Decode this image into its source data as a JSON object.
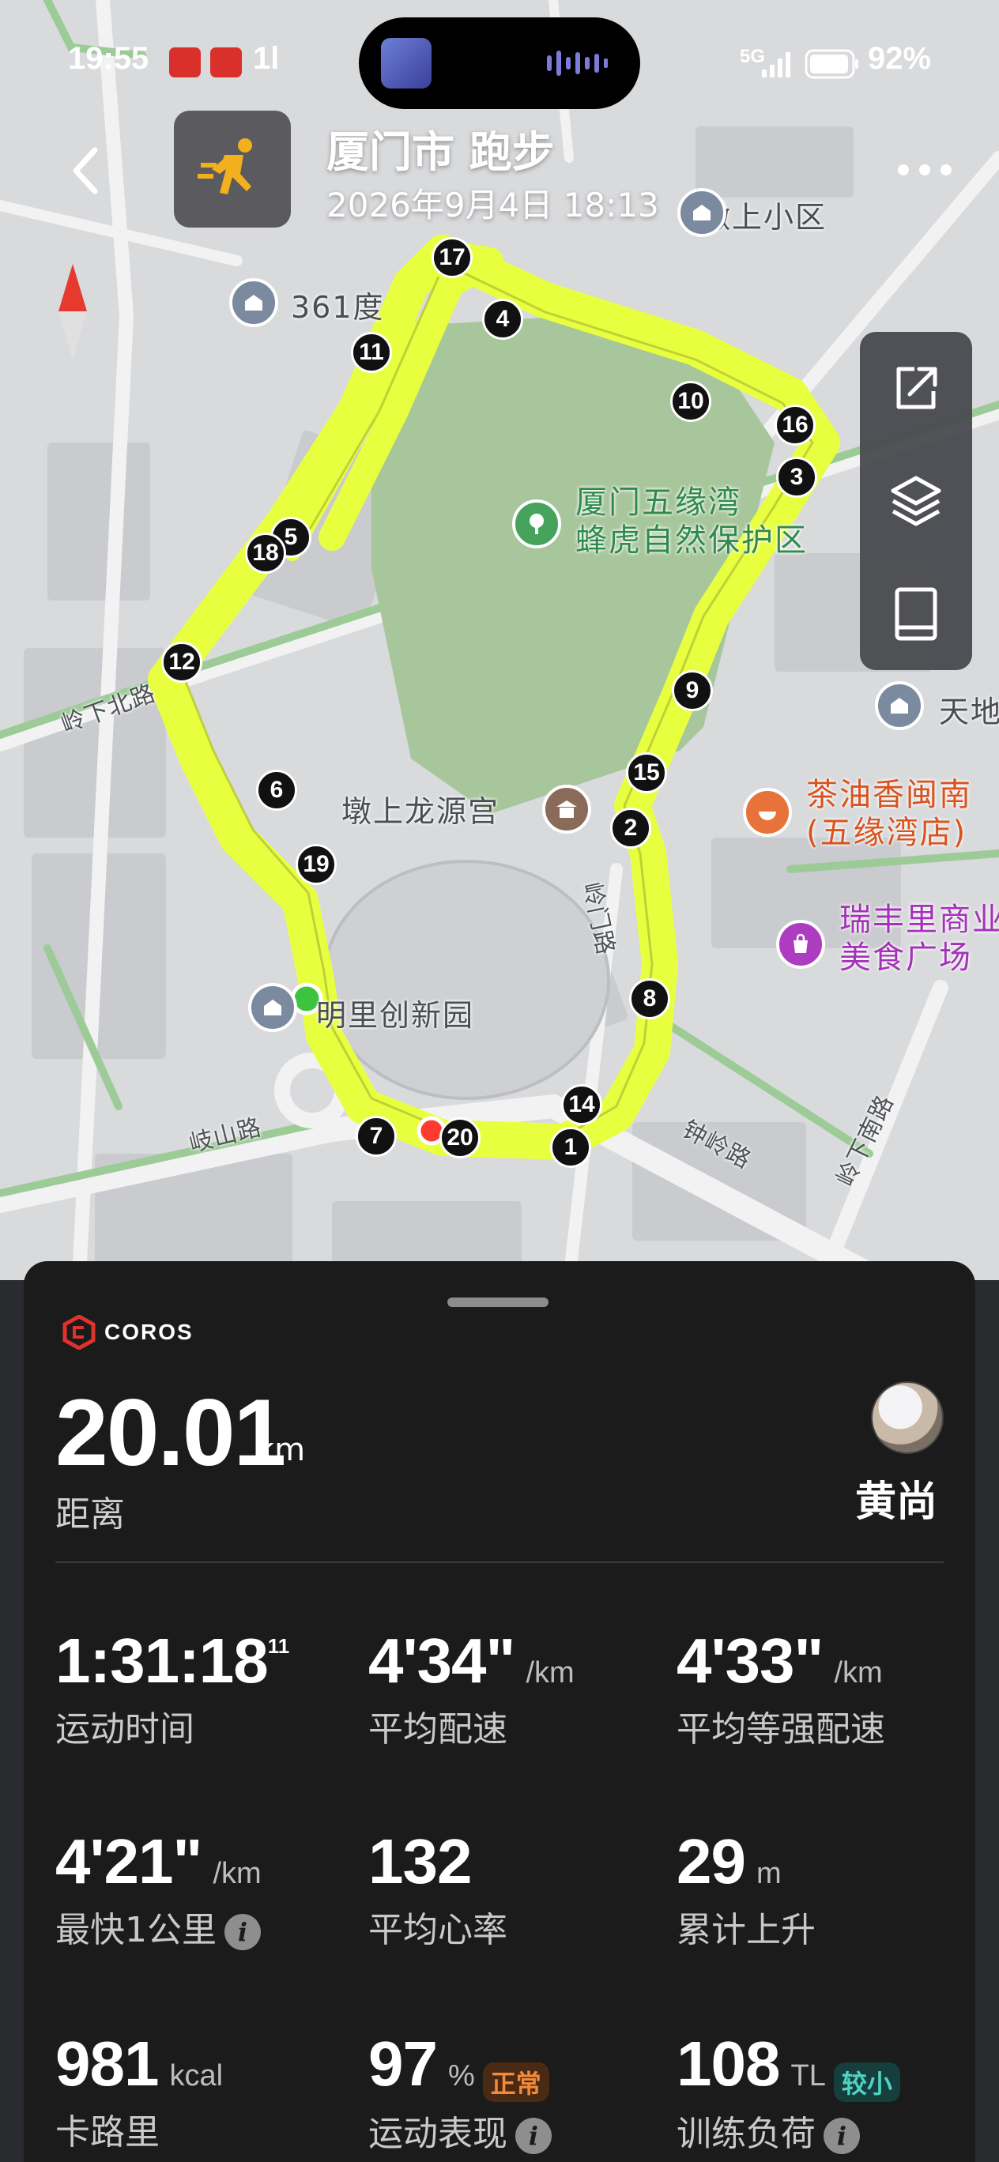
{
  "status_bar": {
    "time": "19:55",
    "signal_mark": "1l",
    "network": "5G",
    "battery": "92%"
  },
  "header": {
    "title": "厦门市 跑步",
    "date": "2026年9月4日 18:13"
  },
  "map": {
    "labels": {
      "dunshang_community": "墩上小区",
      "poi_361": "361度",
      "park_line1": "厦门五缘湾",
      "park_line2": "蜂虎自然保护区",
      "ling_xia_bei_lu": "岭下北路",
      "tian_di": "天地",
      "long_yuan_gong": "墩上龙源宫",
      "chayou_line1": "茶油香闽南",
      "chayou_line2": "(五缘湾店)",
      "ruifeng_line1": "瑞丰里商业",
      "ruifeng_line2": "美食广场",
      "mingli": "明里创新园",
      "qishan_lu": "岐山路",
      "zhongling_lu": "钟岭路",
      "lingmen_lu": "岭门路",
      "ling_xia_nan_lu": "岭下南路"
    },
    "km_markers": [
      "1",
      "2",
      "3",
      "4",
      "5",
      "6",
      "7",
      "8",
      "9",
      "10",
      "11",
      "12",
      "14",
      "15",
      "16",
      "17",
      "18",
      "19",
      "20"
    ],
    "route_color": "#e8ff3f",
    "start_color": "#3ec33e",
    "end_color": "#ff3b30"
  },
  "summary": {
    "brand": "COROS",
    "distance_value": "20.01",
    "distance_unit": "km",
    "distance_label": "距离",
    "user_name": "黄尚"
  },
  "stats": [
    {
      "value": "1:31:18",
      "sup": "11",
      "unit": "",
      "label": "运动时间"
    },
    {
      "value": "4'34\"",
      "unit": "/km",
      "label": "平均配速"
    },
    {
      "value": "4'33\"",
      "unit": "/km",
      "label": "平均等强配速"
    },
    {
      "value": "4'21\"",
      "unit": "/km",
      "label": "最快1公里"
    },
    {
      "value": "132",
      "unit": "",
      "label": "平均心率"
    },
    {
      "value": "29",
      "unit": "m",
      "label": "累计上升"
    },
    {
      "value": "981",
      "unit": "kcal",
      "label": "卡路里"
    },
    {
      "value": "97",
      "unit": "%",
      "badge": "正常",
      "label": "运动表现"
    },
    {
      "value": "108",
      "unit": "TL",
      "badge": "较小",
      "label": "训练负荷"
    }
  ]
}
